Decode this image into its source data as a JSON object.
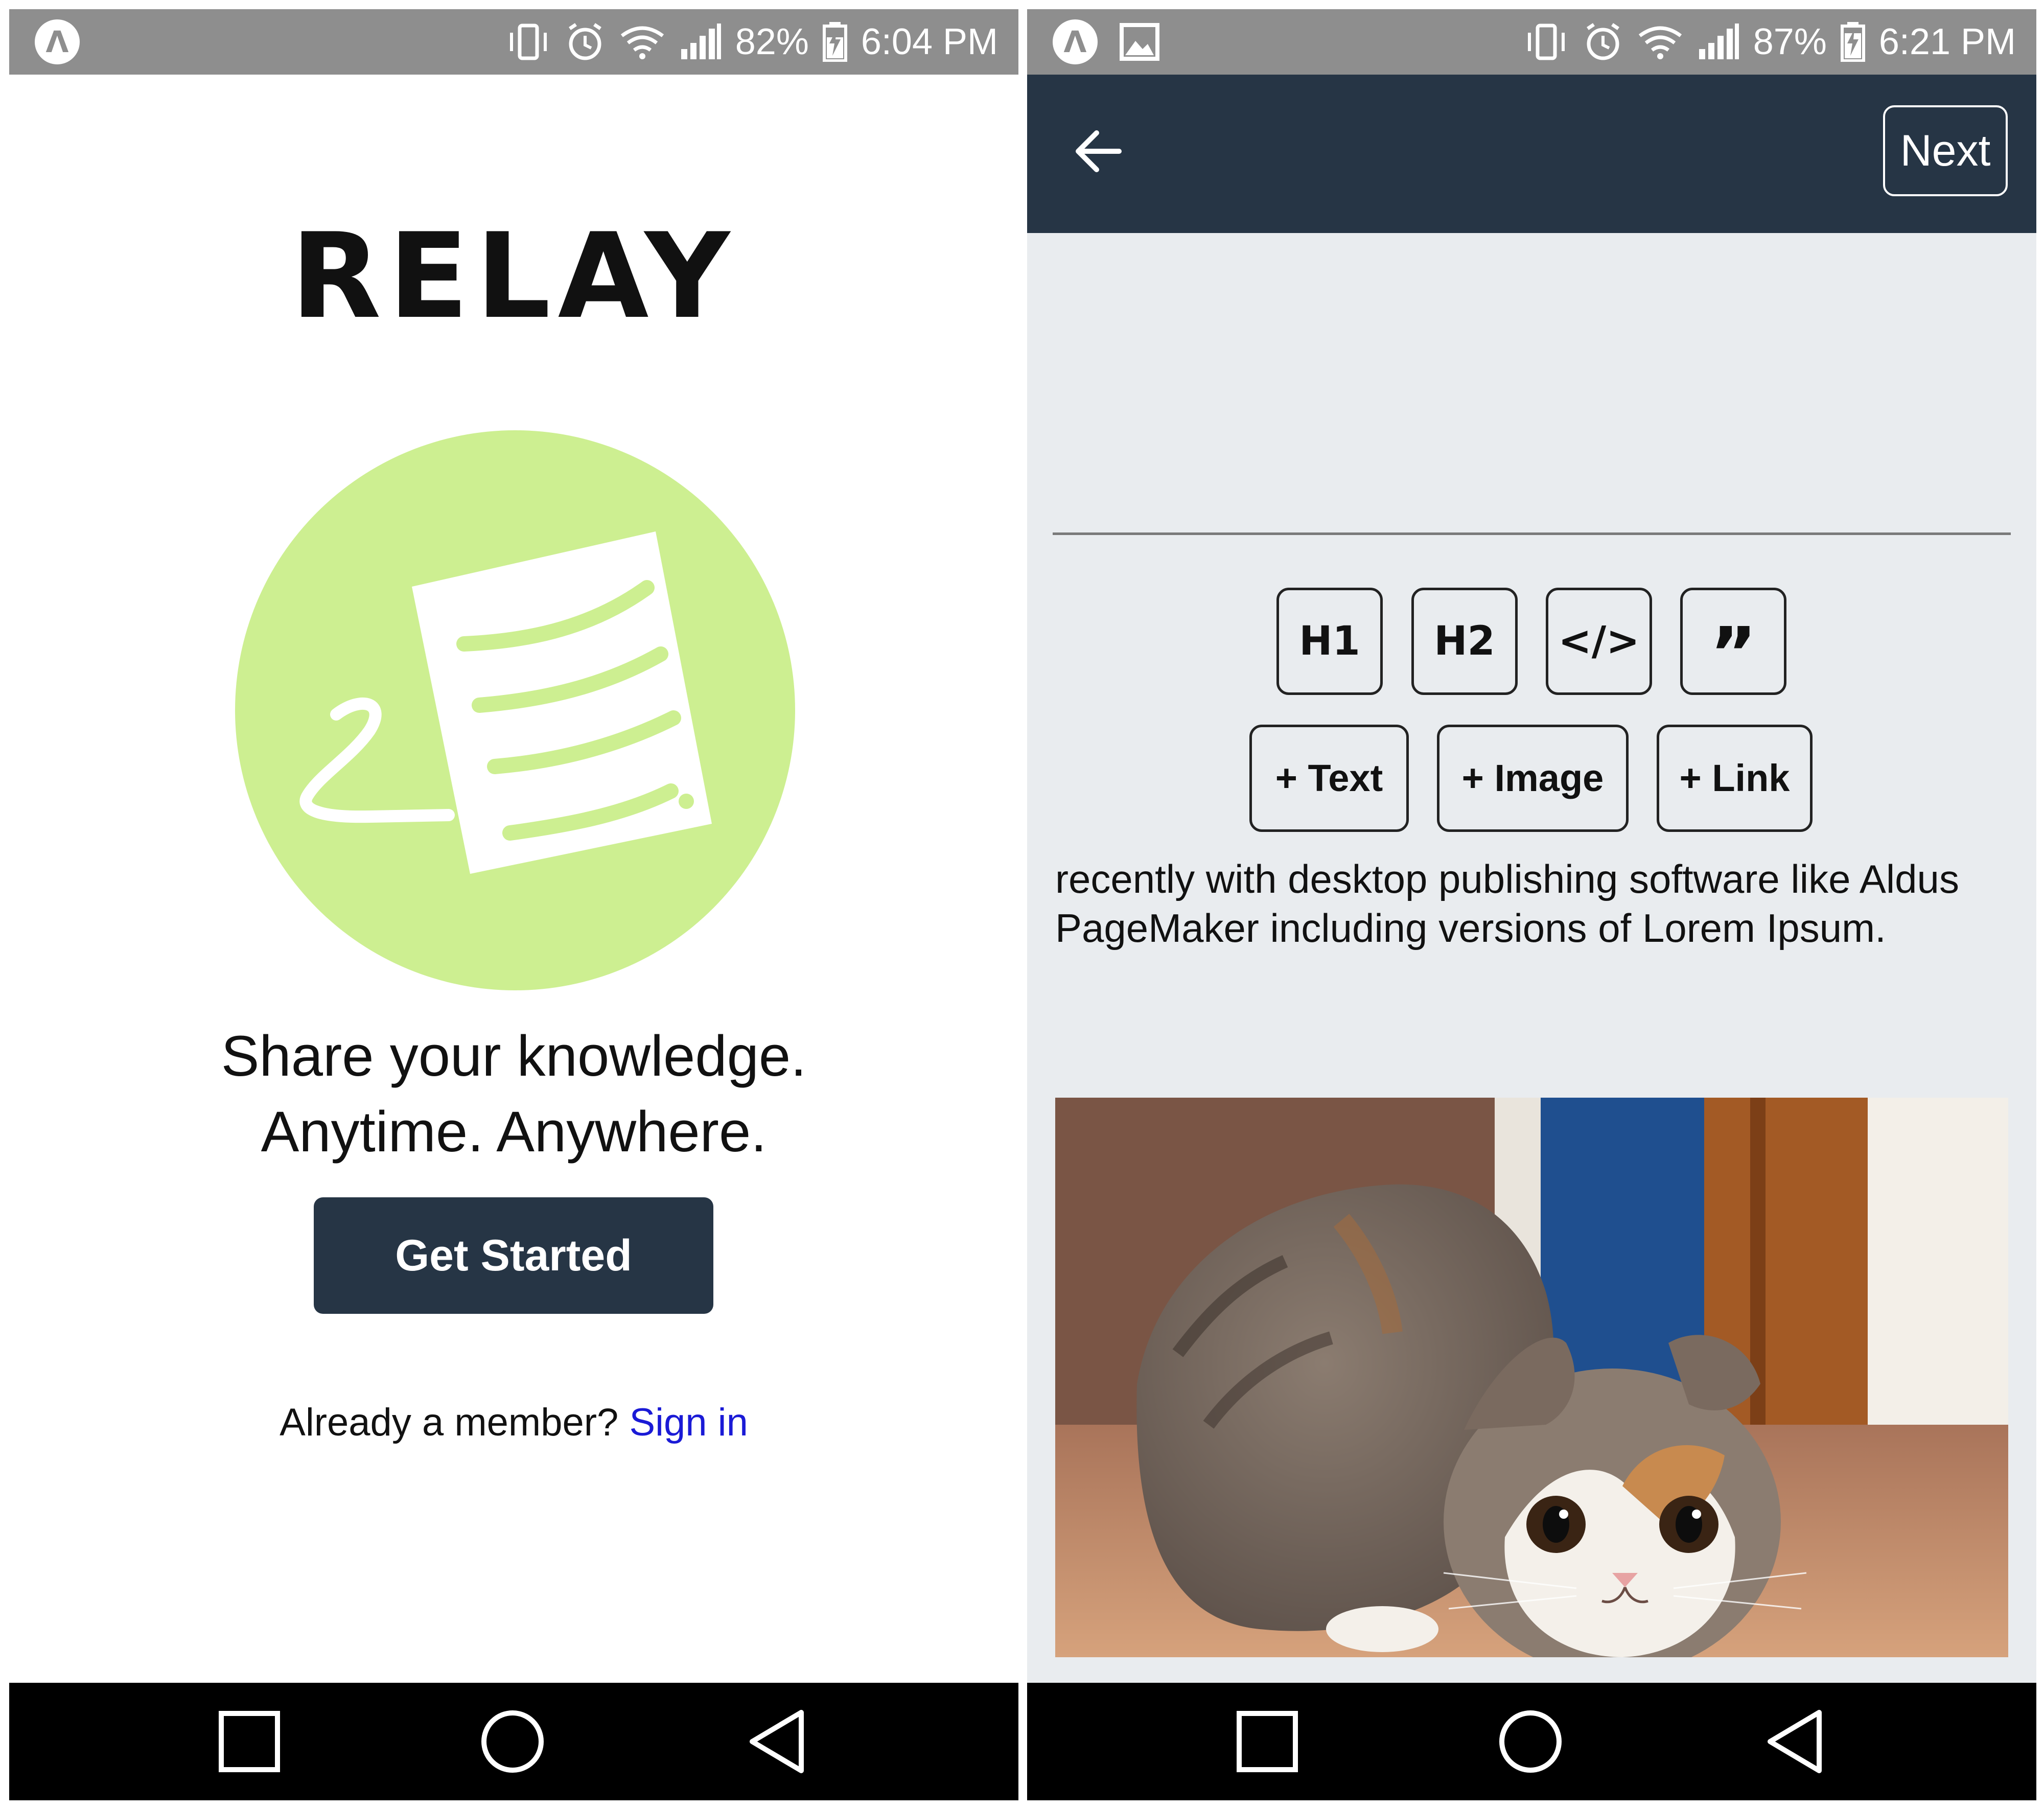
{
  "left_screen": {
    "status_bar": {
      "battery": "82%",
      "time": "6:04 PM"
    },
    "brand": "RELAY",
    "logo": {
      "icon": "document-scroll-icon",
      "circle_color": "#cdef91"
    },
    "tagline_line1": "Share your knowledge.",
    "tagline_line2": "Anytime. Anywhere.",
    "cta_label": "Get Started",
    "signin_prompt": "Already a member?",
    "signin_link": "Sign in"
  },
  "right_screen": {
    "status_bar": {
      "battery": "87%",
      "time": "6:21 PM"
    },
    "appbar": {
      "back_icon": "arrow-left-icon",
      "next_label": "Next"
    },
    "format_buttons": [
      "H1",
      "H2",
      "</>",
      "”"
    ],
    "add_buttons": [
      "+ Text",
      "+ Image",
      "+ Link"
    ],
    "body_text": "recently with desktop publishing software like Aldus PageMaker including versions of Lorem Ipsum.",
    "image": "cat-photo"
  },
  "colors": {
    "accent": "#263545",
    "link": "#1a1ad6",
    "status_bar": "#8e8e8e",
    "editor_bg": "#e9ecef"
  }
}
